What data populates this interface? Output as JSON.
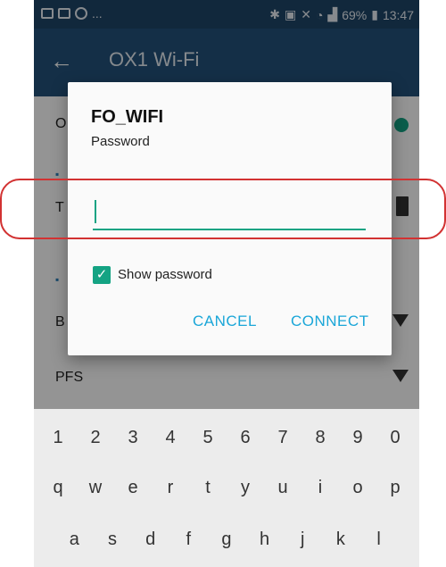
{
  "status_bar": {
    "left_more": "...",
    "battery": "69%",
    "time": "13:47"
  },
  "app_bar": {
    "back_icon": "arrow-left-icon",
    "title": "OX1 Wi-Fi"
  },
  "background_list": {
    "row1_initial": "O",
    "row2_initial": "T",
    "row3_initial": "B",
    "row4_label": "PFS"
  },
  "dialog": {
    "ssid": "FO_WIFI",
    "subtitle": "Password",
    "password_value": "",
    "show_password_label": "Show password",
    "show_password_checked": true,
    "cancel_label": "CANCEL",
    "connect_label": "CONNECT"
  },
  "keyboard": {
    "row1": [
      "1",
      "2",
      "3",
      "4",
      "5",
      "6",
      "7",
      "8",
      "9",
      "0"
    ],
    "row2": [
      "q",
      "w",
      "e",
      "r",
      "t",
      "y",
      "u",
      "i",
      "o",
      "p"
    ],
    "row3": [
      "a",
      "s",
      "d",
      "f",
      "g",
      "h",
      "j",
      "k",
      "l"
    ]
  },
  "colors": {
    "accent": "#14a383",
    "button_text": "#1aa6d8",
    "app_bar": "#23527a",
    "annotation": "#d23232"
  }
}
